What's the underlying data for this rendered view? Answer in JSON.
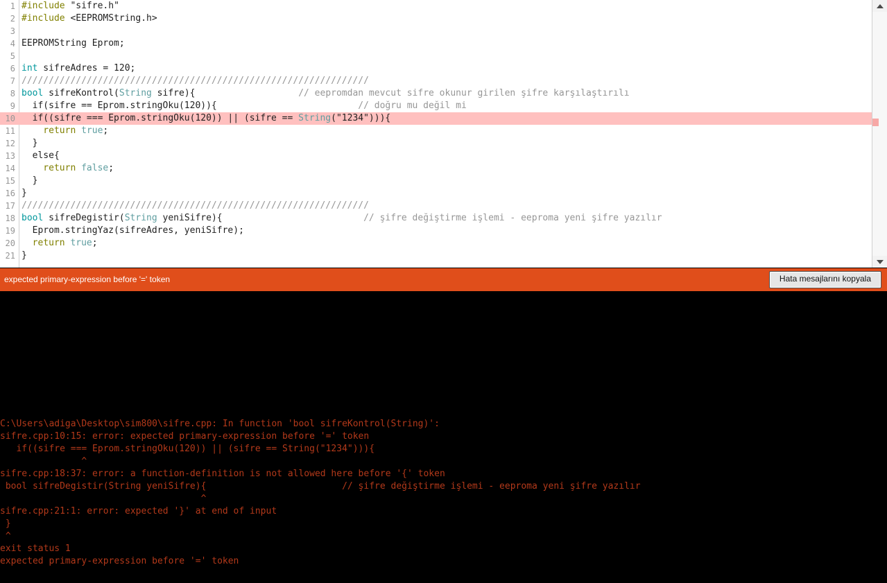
{
  "editor": {
    "lines": [
      {
        "num": "1",
        "error": false,
        "tokens": [
          {
            "c": "t-pre",
            "t": "#include "
          },
          {
            "c": "t-str",
            "t": "\"sifre.h\""
          }
        ]
      },
      {
        "num": "2",
        "error": false,
        "tokens": [
          {
            "c": "t-pre",
            "t": "#include "
          },
          {
            "c": "t-plain",
            "t": "<EEPROMString.h>"
          }
        ]
      },
      {
        "num": "3",
        "error": false,
        "tokens": [
          {
            "c": "t-plain",
            "t": ""
          }
        ]
      },
      {
        "num": "4",
        "error": false,
        "tokens": [
          {
            "c": "t-plain",
            "t": "EEPROMString Eprom;"
          }
        ]
      },
      {
        "num": "5",
        "error": false,
        "tokens": [
          {
            "c": "t-plain",
            "t": ""
          }
        ]
      },
      {
        "num": "6",
        "error": false,
        "tokens": [
          {
            "c": "t-kw",
            "t": "int"
          },
          {
            "c": "t-plain",
            "t": " sifreAdres = 120;"
          }
        ]
      },
      {
        "num": "7",
        "error": false,
        "tokens": [
          {
            "c": "t-cmt",
            "t": "////////////////////////////////////////////////////////////////"
          }
        ]
      },
      {
        "num": "8",
        "error": false,
        "tokens": [
          {
            "c": "t-kw",
            "t": "bool"
          },
          {
            "c": "t-plain",
            "t": " sifreKontrol("
          },
          {
            "c": "t-type",
            "t": "String"
          },
          {
            "c": "t-plain",
            "t": " sifre){                   "
          },
          {
            "c": "t-cmt",
            "t": "// eepromdan mevcut sifre okunur girilen şifre karşılaştırılı"
          }
        ]
      },
      {
        "num": "9",
        "error": false,
        "tokens": [
          {
            "c": "t-plain",
            "t": "  if(sifre == Eprom.stringOku(120)){                          "
          },
          {
            "c": "t-cmt",
            "t": "// doğru mu değil mi"
          }
        ]
      },
      {
        "num": "10",
        "error": true,
        "tokens": [
          {
            "c": "t-plain",
            "t": "  if((sifre === Eprom.stringOku(120)) || (sifre == "
          },
          {
            "c": "t-type",
            "t": "String"
          },
          {
            "c": "t-plain",
            "t": "(\"1234\"))){"
          }
        ]
      },
      {
        "num": "11",
        "error": false,
        "tokens": [
          {
            "c": "t-ret",
            "t": "    return "
          },
          {
            "c": "t-lit",
            "t": "true"
          },
          {
            "c": "t-plain",
            "t": ";"
          }
        ]
      },
      {
        "num": "12",
        "error": false,
        "tokens": [
          {
            "c": "t-plain",
            "t": "  }"
          }
        ]
      },
      {
        "num": "13",
        "error": false,
        "tokens": [
          {
            "c": "t-plain",
            "t": "  else{"
          }
        ]
      },
      {
        "num": "14",
        "error": false,
        "tokens": [
          {
            "c": "t-ret",
            "t": "    return "
          },
          {
            "c": "t-lit",
            "t": "false"
          },
          {
            "c": "t-plain",
            "t": ";"
          }
        ]
      },
      {
        "num": "15",
        "error": false,
        "tokens": [
          {
            "c": "t-plain",
            "t": "  }"
          }
        ]
      },
      {
        "num": "16",
        "error": false,
        "tokens": [
          {
            "c": "t-plain",
            "t": "}"
          }
        ]
      },
      {
        "num": "17",
        "error": false,
        "tokens": [
          {
            "c": "t-cmt",
            "t": "////////////////////////////////////////////////////////////////"
          }
        ]
      },
      {
        "num": "18",
        "error": false,
        "tokens": [
          {
            "c": "t-kw",
            "t": "bool"
          },
          {
            "c": "t-plain",
            "t": " sifreDegistir("
          },
          {
            "c": "t-type",
            "t": "String"
          },
          {
            "c": "t-plain",
            "t": " yeniSifre){                          "
          },
          {
            "c": "t-cmt",
            "t": "// şifre değiştirme işlemi - eeproma yeni şifre yazılır"
          }
        ]
      },
      {
        "num": "19",
        "error": false,
        "tokens": [
          {
            "c": "t-plain",
            "t": "  Eprom.stringYaz(sifreAdres, yeniSifre);"
          }
        ]
      },
      {
        "num": "20",
        "error": false,
        "tokens": [
          {
            "c": "t-ret",
            "t": "  return "
          },
          {
            "c": "t-lit",
            "t": "true"
          },
          {
            "c": "t-plain",
            "t": ";"
          }
        ]
      },
      {
        "num": "21",
        "error": false,
        "tokens": [
          {
            "c": "t-plain",
            "t": "}"
          }
        ]
      }
    ],
    "scrollbar": {
      "up_arrow": "scrollbar-up-arrow-icon",
      "down_arrow": "scrollbar-down-arrow-icon",
      "error_marker": "error-marker"
    }
  },
  "error_bar": {
    "message": "expected primary-expression before '=' token",
    "copy_button_label": "Hata mesajlarını kopyala",
    "background_color": "#e04e1b",
    "text_color": "#ffffff"
  },
  "console": {
    "text_color": "#b3391a",
    "background_color": "#000000",
    "lines": [
      "C:\\Users\\adiga\\Desktop\\sim800\\sifre.cpp: In function 'bool sifreKontrol(String)':",
      "sifre.cpp:10:15: error: expected primary-expression before '=' token",
      "   if((sifre === Eprom.stringOku(120)) || (sifre == String(\"1234\"))){",
      "               ^",
      "sifre.cpp:18:37: error: a function-definition is not allowed here before '{' token",
      " bool sifreDegistir(String yeniSifre){                         // şifre değiştirme işlemi - eeproma yeni şifre yazılır",
      "                                     ^",
      "sifre.cpp:21:1: error: expected '}' at end of input",
      " }",
      " ^",
      "exit status 1",
      "expected primary-expression before '=' token"
    ]
  }
}
